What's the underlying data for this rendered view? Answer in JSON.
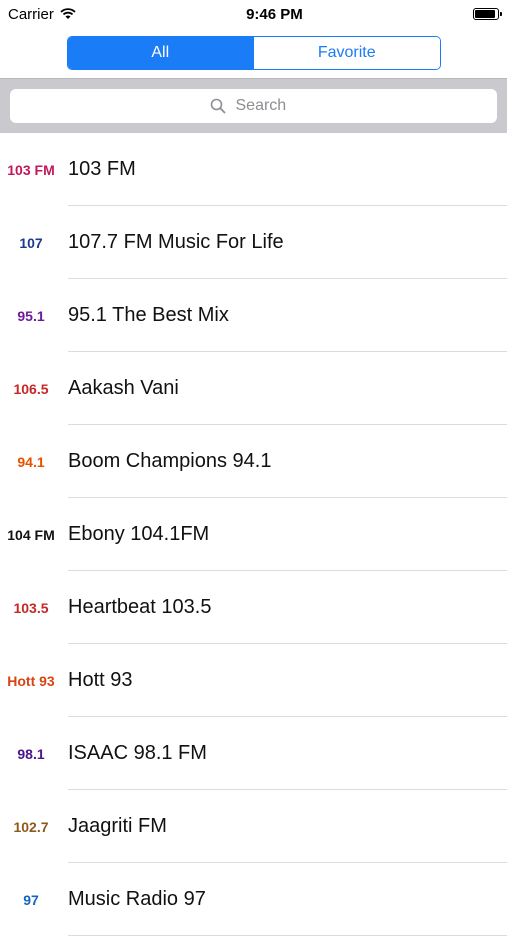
{
  "status_bar": {
    "carrier": "Carrier",
    "time": "9:46 PM"
  },
  "segment": {
    "all": "All",
    "favorite": "Favorite"
  },
  "search": {
    "placeholder": "Search"
  },
  "stations": [
    {
      "name": "103 FM",
      "logo_text": "103 FM",
      "logo_color": "#c2185b"
    },
    {
      "name": "107.7 FM Music For Life",
      "logo_text": "107",
      "logo_color": "#1b3c8c"
    },
    {
      "name": "95.1 The Best Mix",
      "logo_text": "95.1",
      "logo_color": "#6a1b9a"
    },
    {
      "name": "Aakash Vani",
      "logo_text": "106.5",
      "logo_color": "#c62828"
    },
    {
      "name": "Boom Champions 94.1",
      "logo_text": "94.1",
      "logo_color": "#e65100"
    },
    {
      "name": "Ebony 104.1FM",
      "logo_text": "104 FM",
      "logo_color": "#111111"
    },
    {
      "name": "Heartbeat 103.5",
      "logo_text": "103.5",
      "logo_color": "#c62828"
    },
    {
      "name": "Hott 93",
      "logo_text": "Hott 93",
      "logo_color": "#d84315"
    },
    {
      "name": "ISAAC 98.1 FM",
      "logo_text": "98.1",
      "logo_color": "#4a148c"
    },
    {
      "name": "Jaagriti FM",
      "logo_text": "102.7",
      "logo_color": "#8d5a1c"
    },
    {
      "name": "Music Radio 97",
      "logo_text": "97",
      "logo_color": "#1565c0"
    }
  ]
}
